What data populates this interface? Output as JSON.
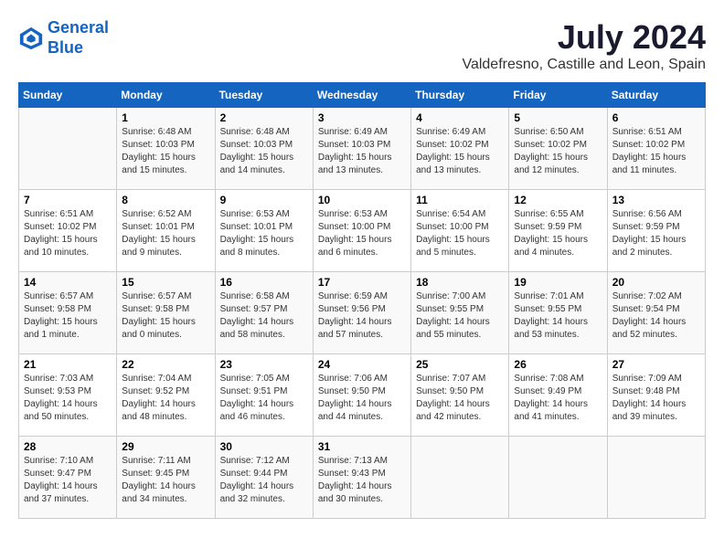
{
  "logo": {
    "line1": "General",
    "line2": "Blue"
  },
  "title": "July 2024",
  "location": "Valdefresno, Castille and Leon, Spain",
  "days_of_week": [
    "Sunday",
    "Monday",
    "Tuesday",
    "Wednesday",
    "Thursday",
    "Friday",
    "Saturday"
  ],
  "weeks": [
    [
      {
        "day": "",
        "content": ""
      },
      {
        "day": "1",
        "content": "Sunrise: 6:48 AM\nSunset: 10:03 PM\nDaylight: 15 hours\nand 15 minutes."
      },
      {
        "day": "2",
        "content": "Sunrise: 6:48 AM\nSunset: 10:03 PM\nDaylight: 15 hours\nand 14 minutes."
      },
      {
        "day": "3",
        "content": "Sunrise: 6:49 AM\nSunset: 10:03 PM\nDaylight: 15 hours\nand 13 minutes."
      },
      {
        "day": "4",
        "content": "Sunrise: 6:49 AM\nSunset: 10:02 PM\nDaylight: 15 hours\nand 13 minutes."
      },
      {
        "day": "5",
        "content": "Sunrise: 6:50 AM\nSunset: 10:02 PM\nDaylight: 15 hours\nand 12 minutes."
      },
      {
        "day": "6",
        "content": "Sunrise: 6:51 AM\nSunset: 10:02 PM\nDaylight: 15 hours\nand 11 minutes."
      }
    ],
    [
      {
        "day": "7",
        "content": "Sunrise: 6:51 AM\nSunset: 10:02 PM\nDaylight: 15 hours\nand 10 minutes."
      },
      {
        "day": "8",
        "content": "Sunrise: 6:52 AM\nSunset: 10:01 PM\nDaylight: 15 hours\nand 9 minutes."
      },
      {
        "day": "9",
        "content": "Sunrise: 6:53 AM\nSunset: 10:01 PM\nDaylight: 15 hours\nand 8 minutes."
      },
      {
        "day": "10",
        "content": "Sunrise: 6:53 AM\nSunset: 10:00 PM\nDaylight: 15 hours\nand 6 minutes."
      },
      {
        "day": "11",
        "content": "Sunrise: 6:54 AM\nSunset: 10:00 PM\nDaylight: 15 hours\nand 5 minutes."
      },
      {
        "day": "12",
        "content": "Sunrise: 6:55 AM\nSunset: 9:59 PM\nDaylight: 15 hours\nand 4 minutes."
      },
      {
        "day": "13",
        "content": "Sunrise: 6:56 AM\nSunset: 9:59 PM\nDaylight: 15 hours\nand 2 minutes."
      }
    ],
    [
      {
        "day": "14",
        "content": "Sunrise: 6:57 AM\nSunset: 9:58 PM\nDaylight: 15 hours\nand 1 minute."
      },
      {
        "day": "15",
        "content": "Sunrise: 6:57 AM\nSunset: 9:58 PM\nDaylight: 15 hours\nand 0 minutes."
      },
      {
        "day": "16",
        "content": "Sunrise: 6:58 AM\nSunset: 9:57 PM\nDaylight: 14 hours\nand 58 minutes."
      },
      {
        "day": "17",
        "content": "Sunrise: 6:59 AM\nSunset: 9:56 PM\nDaylight: 14 hours\nand 57 minutes."
      },
      {
        "day": "18",
        "content": "Sunrise: 7:00 AM\nSunset: 9:55 PM\nDaylight: 14 hours\nand 55 minutes."
      },
      {
        "day": "19",
        "content": "Sunrise: 7:01 AM\nSunset: 9:55 PM\nDaylight: 14 hours\nand 53 minutes."
      },
      {
        "day": "20",
        "content": "Sunrise: 7:02 AM\nSunset: 9:54 PM\nDaylight: 14 hours\nand 52 minutes."
      }
    ],
    [
      {
        "day": "21",
        "content": "Sunrise: 7:03 AM\nSunset: 9:53 PM\nDaylight: 14 hours\nand 50 minutes."
      },
      {
        "day": "22",
        "content": "Sunrise: 7:04 AM\nSunset: 9:52 PM\nDaylight: 14 hours\nand 48 minutes."
      },
      {
        "day": "23",
        "content": "Sunrise: 7:05 AM\nSunset: 9:51 PM\nDaylight: 14 hours\nand 46 minutes."
      },
      {
        "day": "24",
        "content": "Sunrise: 7:06 AM\nSunset: 9:50 PM\nDaylight: 14 hours\nand 44 minutes."
      },
      {
        "day": "25",
        "content": "Sunrise: 7:07 AM\nSunset: 9:50 PM\nDaylight: 14 hours\nand 42 minutes."
      },
      {
        "day": "26",
        "content": "Sunrise: 7:08 AM\nSunset: 9:49 PM\nDaylight: 14 hours\nand 41 minutes."
      },
      {
        "day": "27",
        "content": "Sunrise: 7:09 AM\nSunset: 9:48 PM\nDaylight: 14 hours\nand 39 minutes."
      }
    ],
    [
      {
        "day": "28",
        "content": "Sunrise: 7:10 AM\nSunset: 9:47 PM\nDaylight: 14 hours\nand 37 minutes."
      },
      {
        "day": "29",
        "content": "Sunrise: 7:11 AM\nSunset: 9:45 PM\nDaylight: 14 hours\nand 34 minutes."
      },
      {
        "day": "30",
        "content": "Sunrise: 7:12 AM\nSunset: 9:44 PM\nDaylight: 14 hours\nand 32 minutes."
      },
      {
        "day": "31",
        "content": "Sunrise: 7:13 AM\nSunset: 9:43 PM\nDaylight: 14 hours\nand 30 minutes."
      },
      {
        "day": "",
        "content": ""
      },
      {
        "day": "",
        "content": ""
      },
      {
        "day": "",
        "content": ""
      }
    ]
  ]
}
